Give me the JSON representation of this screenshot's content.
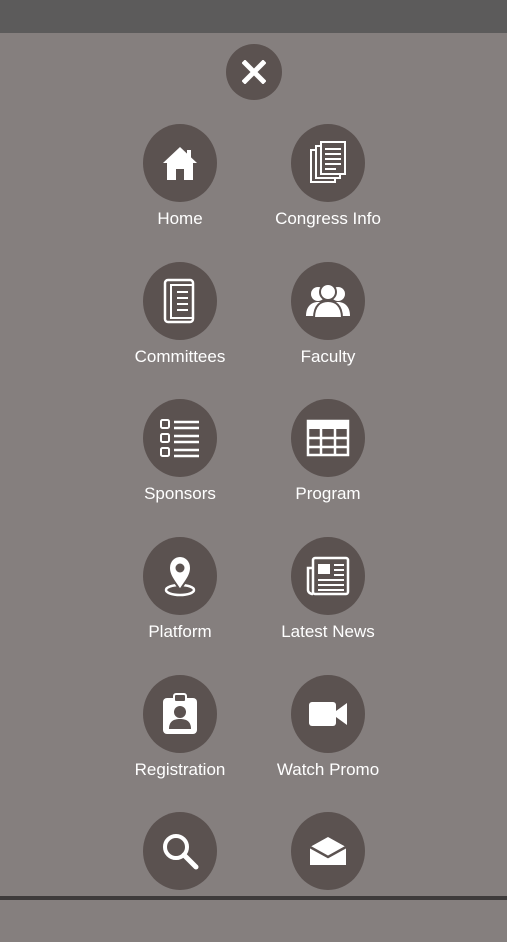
{
  "close_button": {
    "label": "X"
  },
  "menu": {
    "items": [
      {
        "label": "Home",
        "icon": "home-icon"
      },
      {
        "label": "Congress Info",
        "icon": "documents-icon"
      },
      {
        "label": "Committees",
        "icon": "book-icon"
      },
      {
        "label": "Faculty",
        "icon": "people-icon"
      },
      {
        "label": "Sponsors",
        "icon": "checklist-icon"
      },
      {
        "label": "Program",
        "icon": "table-icon"
      },
      {
        "label": "Platform",
        "icon": "location-pin-icon"
      },
      {
        "label": "Latest News",
        "icon": "newspaper-icon"
      },
      {
        "label": "Registration",
        "icon": "badge-icon"
      },
      {
        "label": "Watch Promo",
        "icon": "video-camera-icon"
      },
      {
        "label": "",
        "icon": "search-icon"
      },
      {
        "label": "",
        "icon": "envelope-icon"
      }
    ]
  },
  "colors": {
    "background": "#857f7e",
    "status_bar": "#5c5b5b",
    "circle": "#5b5250",
    "text": "#ffffff"
  }
}
